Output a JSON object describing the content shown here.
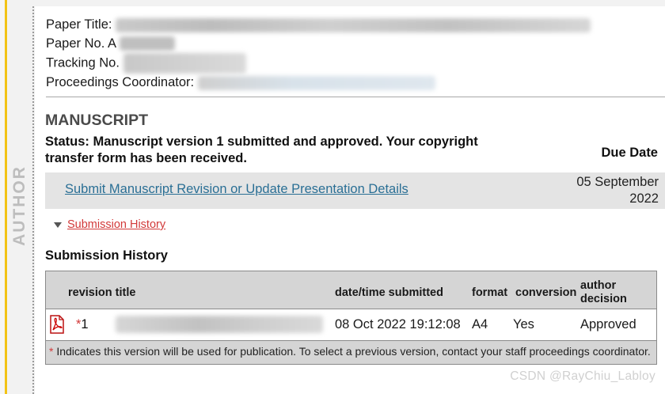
{
  "side_label": "AUTHOR",
  "paper_info": {
    "title_label": "Paper Title:",
    "number_label": "Paper No.",
    "number_partial": "A",
    "tracking_label": "Tracking No.",
    "coordinator_label": "Proceedings Coordinator:"
  },
  "manuscript": {
    "section_title": "MANUSCRIPT",
    "status": "Status: Manuscript version 1 submitted and approved. Your copyright transfer form has been received.",
    "due_date_header": "Due Date",
    "action_link": "Submit Manuscript Revision or Update Presentation Details",
    "due_date_line1": "05 September",
    "due_date_line2": "2022"
  },
  "history": {
    "toggle_label": "Submission History",
    "heading": "Submission History",
    "columns": {
      "revision_title": "revision title",
      "datetime": "date/time submitted",
      "format": "format",
      "conversion": "conversion",
      "decision": "author decision"
    },
    "rows": [
      {
        "star": "*",
        "revision": "1",
        "datetime": "08 Oct 2022 19:12:08",
        "format": "A4",
        "conversion": "Yes",
        "decision": "Approved"
      }
    ],
    "footnote_star": "*",
    "footnote": " Indicates this version will be used for publication. To select a previous version, contact your staff proceedings coordinator."
  },
  "watermark": "CSDN @RayChiu_Labloy",
  "icons": {
    "pdf": "pdf-file-icon",
    "toggle": "triangle-down-icon"
  },
  "colors": {
    "accent_stripe": "#f2c316",
    "link": "#2a6f95",
    "red_link": "#d23a3a"
  }
}
